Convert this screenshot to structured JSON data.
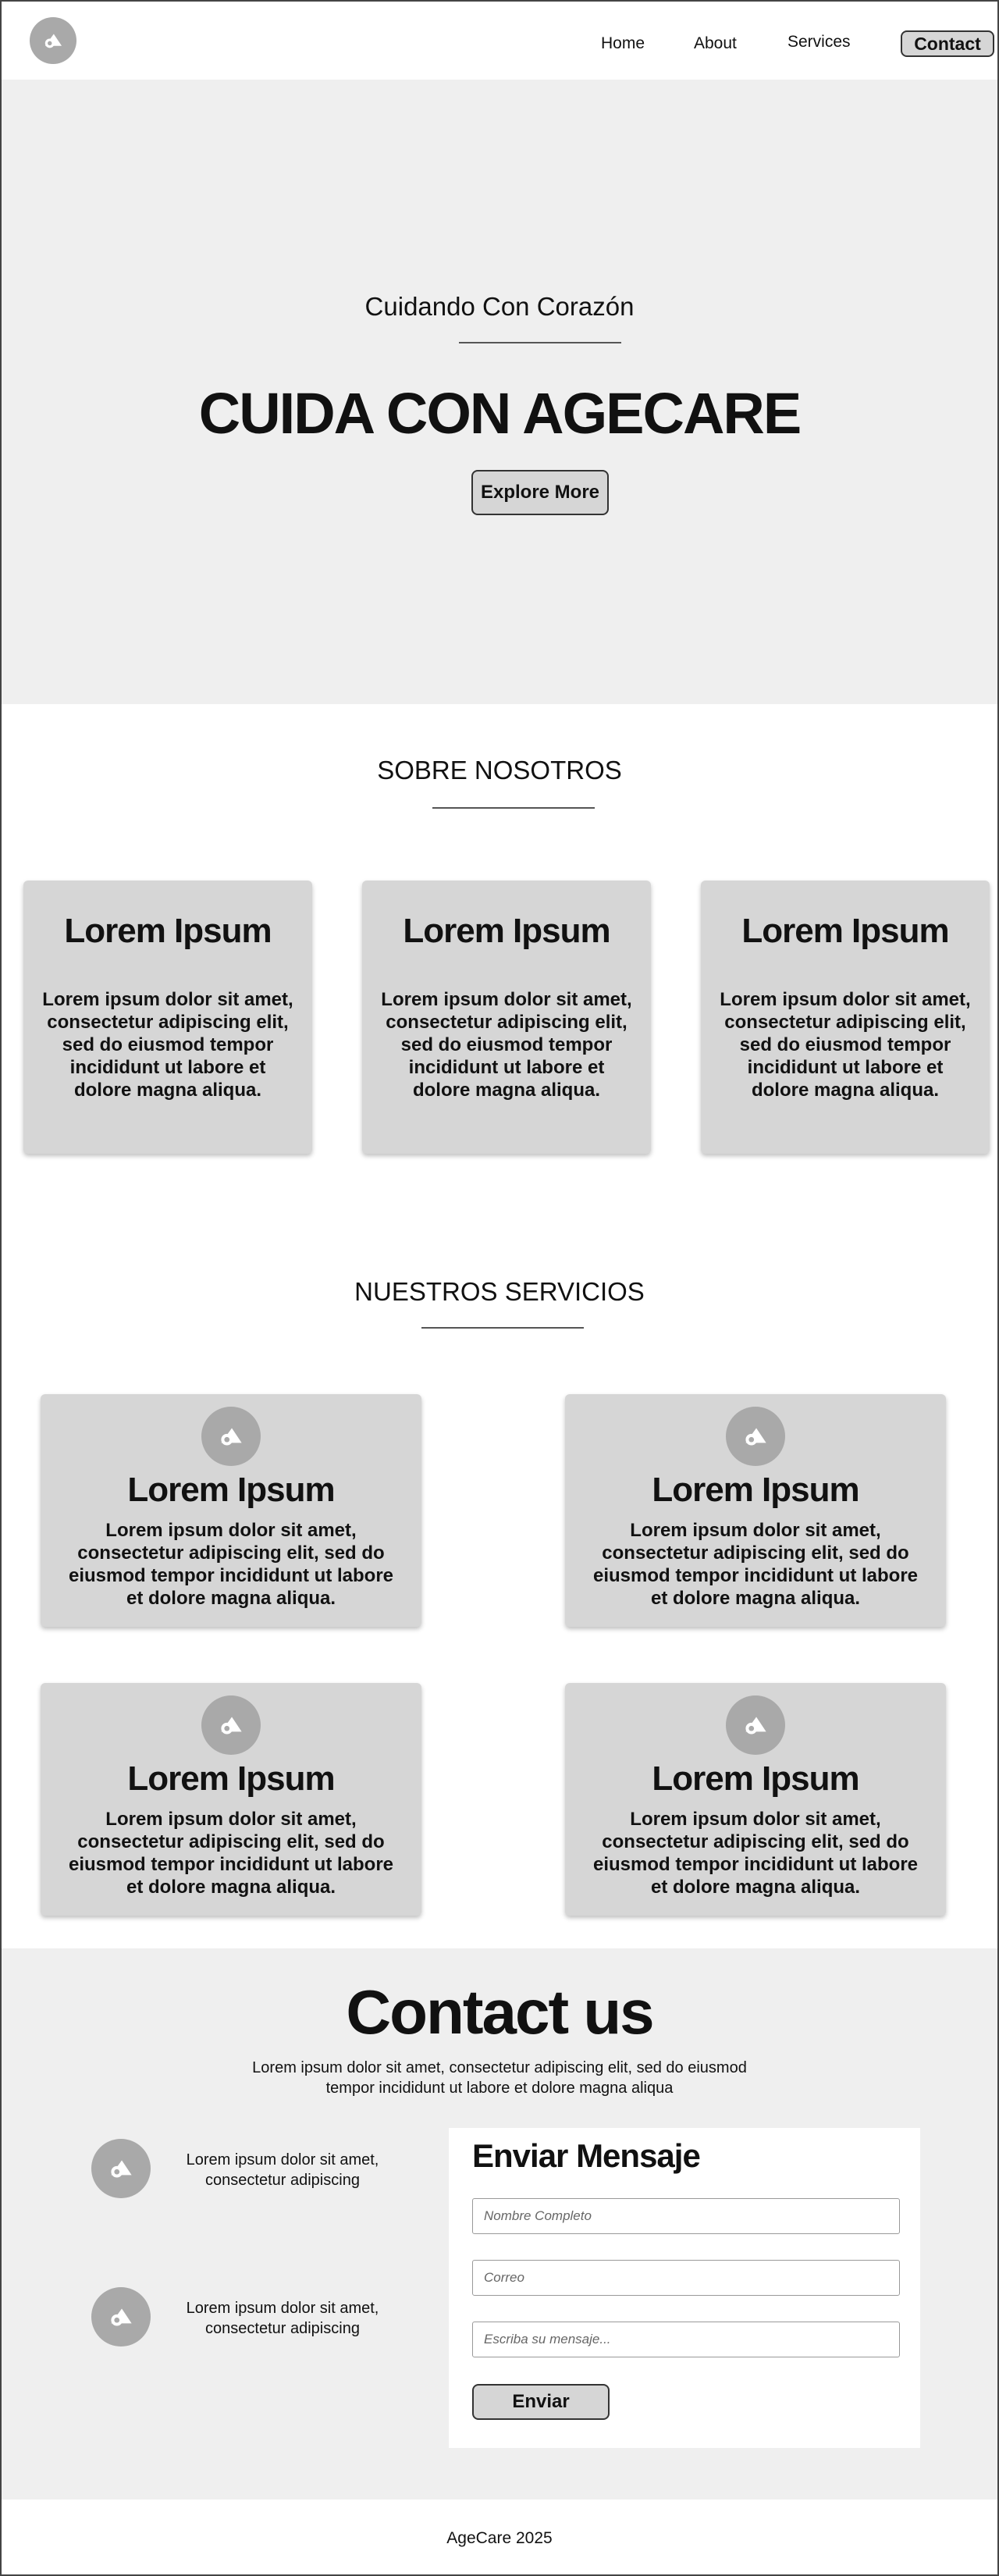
{
  "header": {
    "logo_icon": "logo-icon",
    "nav": [
      {
        "label": "Home"
      },
      {
        "label": "About"
      },
      {
        "label": "Services"
      }
    ],
    "contact_label": "Contact"
  },
  "hero": {
    "subtitle": "Cuidando Con Corazón",
    "title": "CUIDA CON AGECARE",
    "button_label": "Explore More"
  },
  "about": {
    "title": "SOBRE NOSOTROS",
    "cards": [
      {
        "title": "Lorem Ipsum",
        "text": "Lorem ipsum dolor sit amet, consectetur adipiscing elit, sed do eiusmod tempor incididunt ut labore et dolore magna aliqua."
      },
      {
        "title": "Lorem Ipsum",
        "text": "Lorem ipsum dolor sit amet, consectetur adipiscing elit, sed do eiusmod tempor incididunt ut labore et dolore magna aliqua."
      },
      {
        "title": "Lorem Ipsum",
        "text": "Lorem ipsum dolor sit amet, consectetur adipiscing elit, sed do eiusmod tempor incididunt ut labore et dolore magna aliqua."
      }
    ]
  },
  "services": {
    "title": "NUESTROS SERVICIOS",
    "cards": [
      {
        "title": "Lorem Ipsum",
        "text": "Lorem ipsum dolor sit amet, consectetur adipiscing elit, sed do eiusmod tempor incididunt ut labore et dolore magna aliqua."
      },
      {
        "title": "Lorem Ipsum",
        "text": "Lorem ipsum dolor sit amet, consectetur adipiscing elit, sed do eiusmod tempor incididunt ut labore et dolore magna aliqua."
      },
      {
        "title": "Lorem Ipsum",
        "text": "Lorem ipsum dolor sit amet, consectetur adipiscing elit, sed do eiusmod tempor incididunt ut labore et dolore magna aliqua."
      },
      {
        "title": "Lorem Ipsum",
        "text": "Lorem ipsum dolor sit amet, consectetur adipiscing elit, sed do eiusmod tempor incididunt ut labore et dolore magna aliqua."
      }
    ]
  },
  "contact": {
    "title": "Contact us",
    "description": "Lorem ipsum dolor sit amet, consectetur adipiscing elit, sed do eiusmod tempor incididunt ut labore et dolore magna aliqua",
    "info": [
      {
        "text": "Lorem ipsum dolor sit amet, consectetur adipiscing"
      },
      {
        "text": "Lorem ipsum dolor sit amet, consectetur adipiscing"
      }
    ],
    "form": {
      "title": "Enviar Mensaje",
      "name_placeholder": "Nombre Completo",
      "email_placeholder": "Correo",
      "message_placeholder": "Escriba su mensaje...",
      "submit_label": "Enviar"
    }
  },
  "footer": {
    "text": "AgeCare 2025"
  },
  "colors": {
    "hero_bg": "#efefef",
    "card_bg": "#d6d6d6",
    "logo_bg": "#a9a9a9"
  }
}
